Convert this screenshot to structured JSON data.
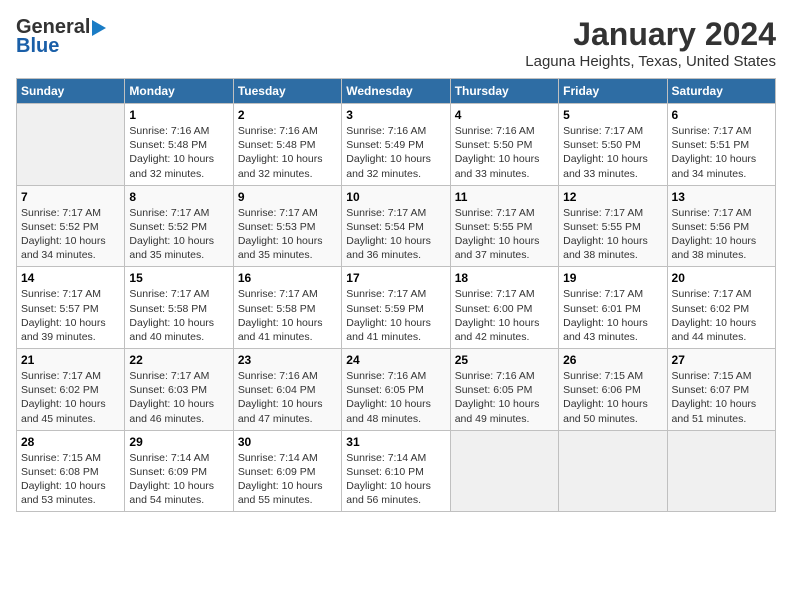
{
  "header": {
    "logo_line1": "General",
    "logo_line2": "Blue",
    "month": "January 2024",
    "location": "Laguna Heights, Texas, United States"
  },
  "weekdays": [
    "Sunday",
    "Monday",
    "Tuesday",
    "Wednesday",
    "Thursday",
    "Friday",
    "Saturday"
  ],
  "weeks": [
    [
      {
        "day": "",
        "info": ""
      },
      {
        "day": "1",
        "info": "Sunrise: 7:16 AM\nSunset: 5:48 PM\nDaylight: 10 hours\nand 32 minutes."
      },
      {
        "day": "2",
        "info": "Sunrise: 7:16 AM\nSunset: 5:48 PM\nDaylight: 10 hours\nand 32 minutes."
      },
      {
        "day": "3",
        "info": "Sunrise: 7:16 AM\nSunset: 5:49 PM\nDaylight: 10 hours\nand 32 minutes."
      },
      {
        "day": "4",
        "info": "Sunrise: 7:16 AM\nSunset: 5:50 PM\nDaylight: 10 hours\nand 33 minutes."
      },
      {
        "day": "5",
        "info": "Sunrise: 7:17 AM\nSunset: 5:50 PM\nDaylight: 10 hours\nand 33 minutes."
      },
      {
        "day": "6",
        "info": "Sunrise: 7:17 AM\nSunset: 5:51 PM\nDaylight: 10 hours\nand 34 minutes."
      }
    ],
    [
      {
        "day": "7",
        "info": "Sunrise: 7:17 AM\nSunset: 5:52 PM\nDaylight: 10 hours\nand 34 minutes."
      },
      {
        "day": "8",
        "info": "Sunrise: 7:17 AM\nSunset: 5:52 PM\nDaylight: 10 hours\nand 35 minutes."
      },
      {
        "day": "9",
        "info": "Sunrise: 7:17 AM\nSunset: 5:53 PM\nDaylight: 10 hours\nand 35 minutes."
      },
      {
        "day": "10",
        "info": "Sunrise: 7:17 AM\nSunset: 5:54 PM\nDaylight: 10 hours\nand 36 minutes."
      },
      {
        "day": "11",
        "info": "Sunrise: 7:17 AM\nSunset: 5:55 PM\nDaylight: 10 hours\nand 37 minutes."
      },
      {
        "day": "12",
        "info": "Sunrise: 7:17 AM\nSunset: 5:55 PM\nDaylight: 10 hours\nand 38 minutes."
      },
      {
        "day": "13",
        "info": "Sunrise: 7:17 AM\nSunset: 5:56 PM\nDaylight: 10 hours\nand 38 minutes."
      }
    ],
    [
      {
        "day": "14",
        "info": "Sunrise: 7:17 AM\nSunset: 5:57 PM\nDaylight: 10 hours\nand 39 minutes."
      },
      {
        "day": "15",
        "info": "Sunrise: 7:17 AM\nSunset: 5:58 PM\nDaylight: 10 hours\nand 40 minutes."
      },
      {
        "day": "16",
        "info": "Sunrise: 7:17 AM\nSunset: 5:58 PM\nDaylight: 10 hours\nand 41 minutes."
      },
      {
        "day": "17",
        "info": "Sunrise: 7:17 AM\nSunset: 5:59 PM\nDaylight: 10 hours\nand 41 minutes."
      },
      {
        "day": "18",
        "info": "Sunrise: 7:17 AM\nSunset: 6:00 PM\nDaylight: 10 hours\nand 42 minutes."
      },
      {
        "day": "19",
        "info": "Sunrise: 7:17 AM\nSunset: 6:01 PM\nDaylight: 10 hours\nand 43 minutes."
      },
      {
        "day": "20",
        "info": "Sunrise: 7:17 AM\nSunset: 6:02 PM\nDaylight: 10 hours\nand 44 minutes."
      }
    ],
    [
      {
        "day": "21",
        "info": "Sunrise: 7:17 AM\nSunset: 6:02 PM\nDaylight: 10 hours\nand 45 minutes."
      },
      {
        "day": "22",
        "info": "Sunrise: 7:17 AM\nSunset: 6:03 PM\nDaylight: 10 hours\nand 46 minutes."
      },
      {
        "day": "23",
        "info": "Sunrise: 7:16 AM\nSunset: 6:04 PM\nDaylight: 10 hours\nand 47 minutes."
      },
      {
        "day": "24",
        "info": "Sunrise: 7:16 AM\nSunset: 6:05 PM\nDaylight: 10 hours\nand 48 minutes."
      },
      {
        "day": "25",
        "info": "Sunrise: 7:16 AM\nSunset: 6:05 PM\nDaylight: 10 hours\nand 49 minutes."
      },
      {
        "day": "26",
        "info": "Sunrise: 7:15 AM\nSunset: 6:06 PM\nDaylight: 10 hours\nand 50 minutes."
      },
      {
        "day": "27",
        "info": "Sunrise: 7:15 AM\nSunset: 6:07 PM\nDaylight: 10 hours\nand 51 minutes."
      }
    ],
    [
      {
        "day": "28",
        "info": "Sunrise: 7:15 AM\nSunset: 6:08 PM\nDaylight: 10 hours\nand 53 minutes."
      },
      {
        "day": "29",
        "info": "Sunrise: 7:14 AM\nSunset: 6:09 PM\nDaylight: 10 hours\nand 54 minutes."
      },
      {
        "day": "30",
        "info": "Sunrise: 7:14 AM\nSunset: 6:09 PM\nDaylight: 10 hours\nand 55 minutes."
      },
      {
        "day": "31",
        "info": "Sunrise: 7:14 AM\nSunset: 6:10 PM\nDaylight: 10 hours\nand 56 minutes."
      },
      {
        "day": "",
        "info": ""
      },
      {
        "day": "",
        "info": ""
      },
      {
        "day": "",
        "info": ""
      }
    ]
  ]
}
